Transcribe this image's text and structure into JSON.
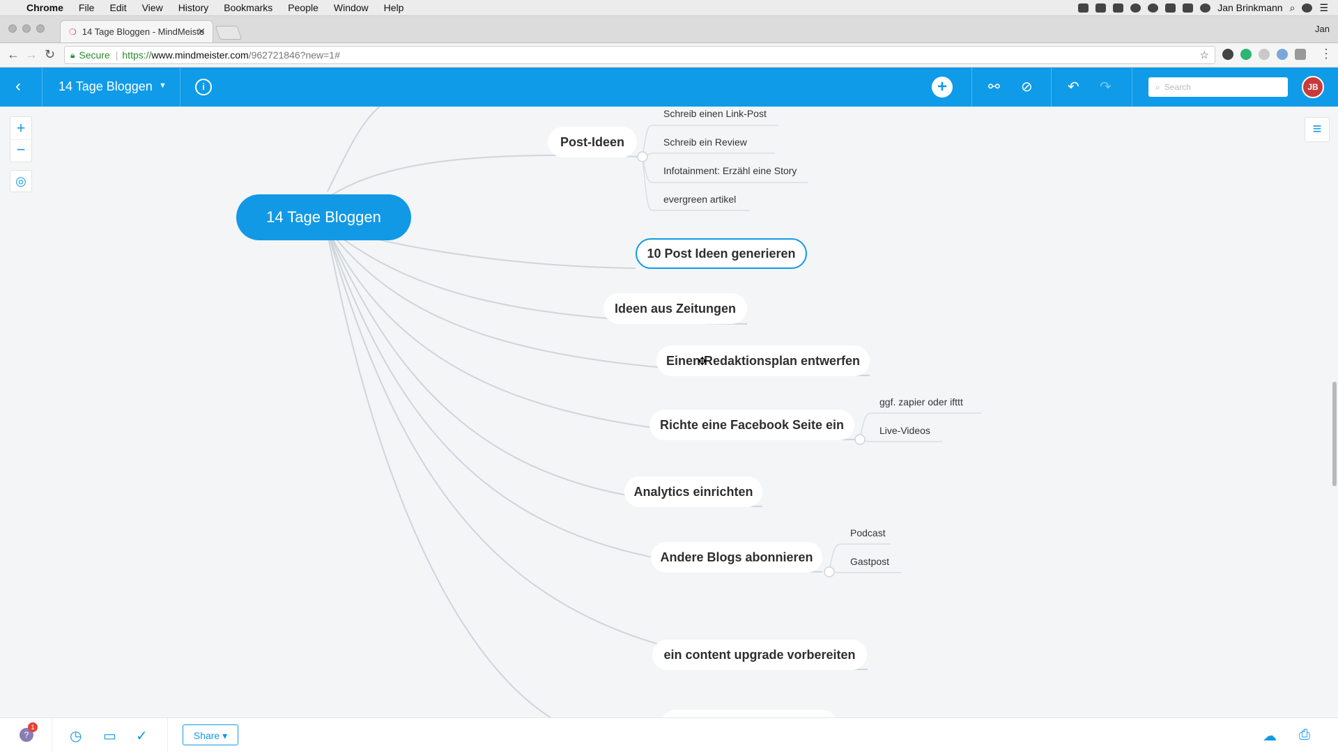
{
  "menubar": {
    "app": "Chrome",
    "items": [
      "File",
      "Edit",
      "View",
      "History",
      "Bookmarks",
      "People",
      "Window",
      "Help"
    ],
    "user": "Jan Brinkmann"
  },
  "browser": {
    "tab_title": "14 Tage Bloggen - MindMeiste",
    "profile": "Jan",
    "secure_label": "Secure",
    "url_scheme": "https://",
    "url_host": "www.mindmeister.com",
    "url_path": "/962721846?new=1#"
  },
  "toolbar": {
    "map_title": "14 Tage Bloggen",
    "search_placeholder": "Search",
    "avatar_initials": "JB"
  },
  "mindmap": {
    "root": "14 Tage Bloggen",
    "topics": [
      {
        "label": "Post-Ideen",
        "children": [
          "Schreib einen Link-Post",
          "Schreib ein Review",
          "Infotainment: Erzähl eine Story",
          "evergreen artikel"
        ]
      },
      {
        "label": "10 Post Ideen generieren",
        "selected": true,
        "children": []
      },
      {
        "label": "Ideen aus Zeitungen",
        "children": []
      },
      {
        "label": "Einen Redaktionsplan entwerfen",
        "children": []
      },
      {
        "label": "Richte eine Facebook Seite ein",
        "children": [
          "ggf. zapier oder ifttt",
          "Live-Videos"
        ]
      },
      {
        "label": "Analytics einrichten",
        "children": []
      },
      {
        "label": "Andere Blogs abonnieren",
        "children": [
          "Podcast",
          "Gastpost"
        ]
      },
      {
        "label": "ein content upgrade vorbereiten",
        "children": []
      }
    ]
  },
  "bottombar": {
    "share_label": "Share",
    "help_badge": "1"
  },
  "colors": {
    "accent": "#1199e6",
    "toolbar": "#0f9be8",
    "canvas": "#f3f5f7",
    "avatar": "#c93a3a"
  },
  "icons": {
    "zoom_in": "plus-icon",
    "zoom_out": "minus-icon",
    "center": "target-icon",
    "menu": "hamburger-icon",
    "history": "history-icon",
    "present": "presentation-icon",
    "tasks": "checkmark-icon",
    "download": "cloud-download-icon",
    "print": "print-icon"
  }
}
